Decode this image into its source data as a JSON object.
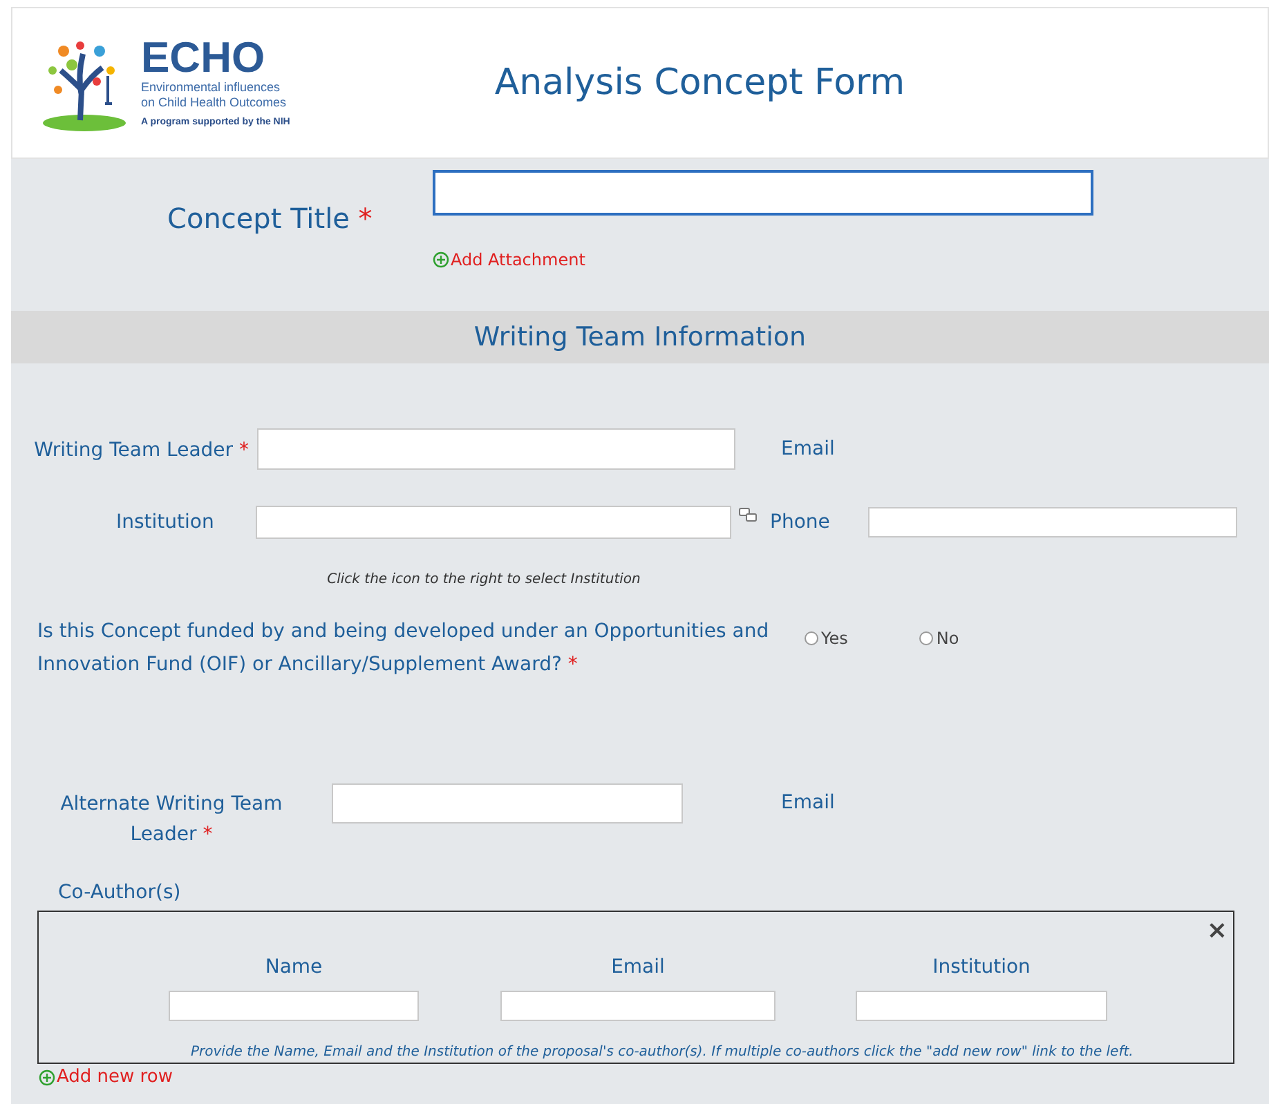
{
  "header": {
    "logo": {
      "name": "ECHO",
      "tagline_1": "Environmental influences",
      "tagline_2": "on Child Health Outcomes",
      "support": "A program supported by the NIH"
    },
    "title": "Analysis Concept Form"
  },
  "concept_title": {
    "label": "Concept Title",
    "required_mark": "*",
    "attachment_link": "Add Attachment"
  },
  "section": {
    "title": "Writing Team Information"
  },
  "leader": {
    "label": "Writing Team Leader",
    "required_mark": "*",
    "email_label": "Email"
  },
  "institution": {
    "label": "Institution",
    "phone_label": "Phone",
    "hint": "Click the icon to the right to select Institution"
  },
  "question": {
    "text": "Is this Concept funded by and being developed under an Opportunities and Innovation Fund (OIF) or Ancillary/Supplement Award?",
    "required_mark": "*",
    "options": [
      {
        "label": "Yes",
        "selected": false
      },
      {
        "label": "No",
        "selected": false
      }
    ]
  },
  "alternate": {
    "label": "Alternate Writing Team Leader",
    "required_mark": "*",
    "email_label": "Email"
  },
  "co_authors": {
    "label": "Co-Author(s)",
    "close": "×",
    "columns": [
      "Name",
      "Email",
      "Institution"
    ],
    "note": "Provide the Name, Email and the Institution of the proposal's co-author(s).  If multiple co-authors click the \"add new row\" link to the left.",
    "add_link": "Add new row"
  }
}
